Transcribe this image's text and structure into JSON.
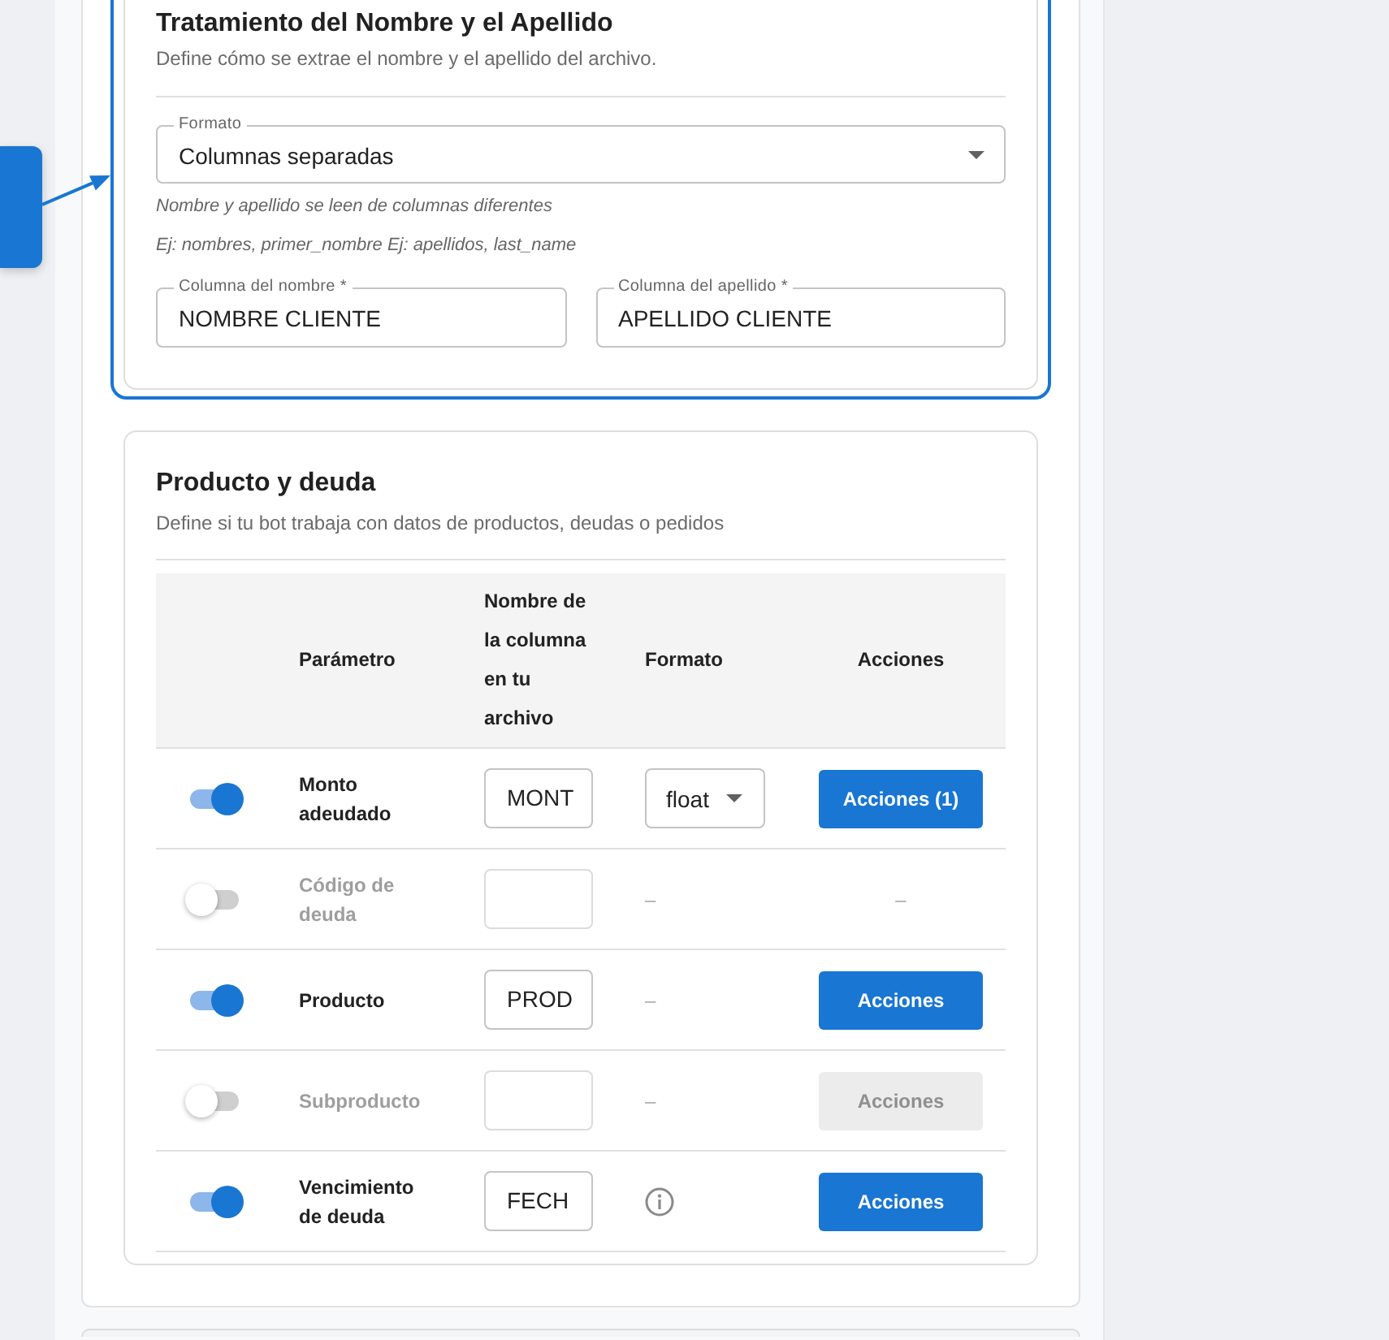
{
  "name_section": {
    "highlighted": true,
    "title": "Tratamiento del Nombre y el Apellido",
    "subtitle": "Define cómo se extrae el nombre y el apellido del archivo.",
    "format_select": {
      "label": "Formato",
      "value": "Columnas separadas"
    },
    "hints": [
      "Nombre y apellido se leen de columnas diferentes",
      "Ej: nombres, primer_nombre Ej: apellidos, last_name"
    ],
    "fields": [
      {
        "label": "Columna del nombre *",
        "value": "NOMBRE CLIENTE"
      },
      {
        "label": "Columna del apellido *",
        "value": "APELLIDO CLIENTE"
      }
    ]
  },
  "product_section": {
    "title": "Producto y deuda",
    "subtitle": "Define si tu bot trabaja con datos de productos, deudas o pedidos",
    "table": {
      "columns": [
        "Parámetro",
        "Nombre de la columna en tu archivo",
        "Formato",
        "Acciones"
      ],
      "rows": [
        {
          "enabled": true,
          "parameter": "Monto adeudado",
          "column_value": "MONT",
          "format": {
            "kind": "select",
            "value": "float"
          },
          "action": {
            "kind": "button",
            "label": "Acciones (1)",
            "disabled": false
          }
        },
        {
          "enabled": false,
          "parameter": "Código de deuda",
          "format": {
            "kind": "dash",
            "text": "–"
          },
          "action": {
            "kind": "dash",
            "text": "–"
          }
        },
        {
          "enabled": true,
          "parameter": "Producto",
          "column_value": "PROD",
          "format": {
            "kind": "dash",
            "text": "–"
          },
          "action": {
            "kind": "button",
            "label": "Acciones",
            "disabled": false
          }
        },
        {
          "enabled": false,
          "parameter": "Subproducto",
          "format": {
            "kind": "dash",
            "text": "–"
          },
          "action": {
            "kind": "button",
            "label": "Acciones",
            "disabled": true
          }
        },
        {
          "enabled": true,
          "parameter": "Vencimiento de deuda",
          "column_value": "FECH",
          "format": {
            "kind": "info"
          },
          "action": {
            "kind": "button",
            "label": "Acciones",
            "disabled": false
          }
        }
      ]
    }
  }
}
